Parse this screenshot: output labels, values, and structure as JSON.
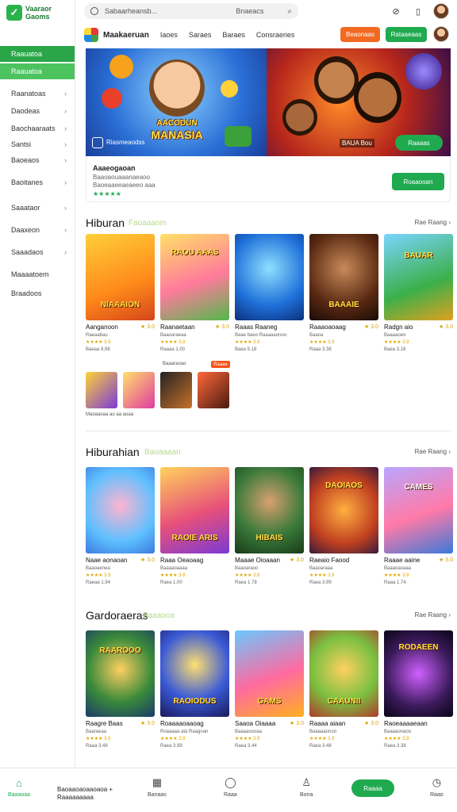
{
  "app": {
    "logo_line1": "Vaaraor",
    "logo_line2": "Gaoms"
  },
  "sidebar": {
    "primary_tab": "Raauatoa",
    "secondary_tab": "Raauatoa",
    "items": [
      {
        "label": "Raanatoas"
      },
      {
        "label": "Daodeas"
      },
      {
        "label": "Baochaaraats"
      },
      {
        "label": "Santsi"
      },
      {
        "label": "Baoeaos"
      },
      {
        "label": "Baoitanes"
      },
      {
        "label": "Saaataor"
      },
      {
        "label": "Daaxeon"
      },
      {
        "label": "Saaadaos"
      },
      {
        "label": "Maaaatoem"
      },
      {
        "label": "Braadoos"
      }
    ]
  },
  "search": {
    "placeholder": "Sabaarheansb...",
    "value": "Bnaeacs"
  },
  "brand": {
    "name": "Maakaeruan"
  },
  "nav": {
    "links": [
      "Iaoes",
      "Saraes",
      "Baraes",
      "Consraeries"
    ]
  },
  "actions": {
    "orange_label": "Beaonaas",
    "green_label": "Rataaeaas"
  },
  "hero": {
    "title_line1": "AACODUN",
    "title_line2": "MANASIA",
    "caption": "Riasmeaodss",
    "badge": "BAUA Bou",
    "cta_label": "Raaaas"
  },
  "featured": {
    "title": "Aaaeogaoan",
    "subtitle": "Baaoaouaaanaeaoo Baoeaaeeaeaeeo aaa",
    "stars": "★★★★★",
    "button_label": "Roaaooan"
  },
  "sections": [
    {
      "title": "Hiburan",
      "tag": "Faoaaaom",
      "see_all": "Rae Raang ›",
      "cards": [
        {
          "title": "Aanganoon",
          "rating": "★ 3.0",
          "sub": "Raeaabau",
          "meta": "★★★★ 3.9",
          "extra": "Baeaa 9,98",
          "art": "NIAAAION"
        },
        {
          "title": "Raanaetaan",
          "rating": "★ 3.0",
          "sub": "Baaoaraeaa",
          "meta": "★★★★ 3.8",
          "extra": "Raaaa 1.00",
          "art": "RAOU AAAS"
        },
        {
          "title": "Raaas Raaneg",
          "rating": "",
          "sub": "Baae baeo Raaaaaonoo",
          "meta": "★★★★ 3.9",
          "extra": "Baea 5.18",
          "art": ""
        },
        {
          "title": "Raaaoaoaag",
          "rating": "★ 3.0",
          "sub": "Baaoa",
          "meta": "★★★★ 3.9",
          "extra": "Raaa 3.38",
          "art": "BAAAIE"
        },
        {
          "title": "Radgn aio",
          "rating": "★ 3.0",
          "sub": "Baaaaoeo",
          "meta": "★★★★ 3.9",
          "extra": "Baea 3.18",
          "art": "BAUAR"
        }
      ]
    },
    {
      "title": "Hiburahian",
      "tag": "Baoaaaan",
      "see_all": "Rae Raang ›",
      "cards": [
        {
          "title": "Naae aonaoan",
          "rating": "★ 3.0",
          "sub": "Baaoaenea",
          "meta": "★★★★ 3.9",
          "extra": "Raeaa 1.94",
          "art": ""
        },
        {
          "title": "Raaa Oeaoaag",
          "rating": "",
          "sub": "Baaaaoaaaa",
          "meta": "★★★★ 3.8",
          "extra": "Raea 1.00",
          "art": "RAOIE ARIS"
        },
        {
          "title": "Maaae Oioaaan",
          "rating": "★ 3.0",
          "sub": "Baaoaraoo",
          "meta": "★★★★ 3.8",
          "extra": "Raea 1.78",
          "art": "HIBAIS"
        },
        {
          "title": "Raeaio Faood",
          "rating": "",
          "sub": "Baaoaraaa",
          "meta": "★★★★ 3.9",
          "extra": "Raea 3.99",
          "art": "DAOIAOS"
        },
        {
          "title": "Raaae aaine",
          "rating": "★ 3.0",
          "sub": "Baaaoaoaaa",
          "meta": "★★★★ 3.9",
          "extra": "Raaa 1.74",
          "art": "CAMES"
        }
      ]
    },
    {
      "title": "Gardoraeras",
      "tag": "Baaaooa",
      "see_all": "Rae Raang ›",
      "cards": [
        {
          "title": "Raagre Baas",
          "rating": "★ 3.0",
          "sub": "Baaraeaa",
          "meta": "★★★★ 3.9",
          "extra": "Raaa 3.48",
          "art": "RAAROOO"
        },
        {
          "title": "Roaaaaoaaoag",
          "rating": "",
          "sub": "Roaaaaa ata Raagnan",
          "meta": "★★★★ 3.9",
          "extra": "Raea 3.99",
          "art": "RAOIODUS"
        },
        {
          "title": "Saaoa Oiaaaa",
          "rating": "★ 3.0",
          "sub": "Baaaaoooaa",
          "meta": "★★★★ 3.9",
          "extra": "Raea 3.44",
          "art": "GAMS"
        },
        {
          "title": "Raaaa aiaan",
          "rating": "★ 3.0",
          "sub": "Baaaaaonoo",
          "meta": "★★★★ 3.9",
          "extra": "Raea 3.48",
          "art": "CAAUNII"
        },
        {
          "title": "Raoeaaaaeaan",
          "rating": "",
          "sub": "Baaaaonaoo",
          "meta": "★★★★ 3.9",
          "extra": "Raea 3.38",
          "art": "RODAEEN"
        }
      ]
    }
  ],
  "mini": {
    "caption": "Maoaaoaa ao aa aoaa",
    "label": "Baaaraoao",
    "tag": "Raaae"
  },
  "bottom_nav": {
    "home_label": "Baaaoaa",
    "promo_text": "Baoaaoaoaaoaoa + Raaaaaaaaa",
    "item2_label": "Banaas",
    "item3_label": "Raaa",
    "item4_label": "Bona",
    "cta_label": "Raaaa",
    "item5_label": "Raao"
  },
  "colors": {
    "accent": "#1faa4f",
    "orange": "#f26a21"
  }
}
